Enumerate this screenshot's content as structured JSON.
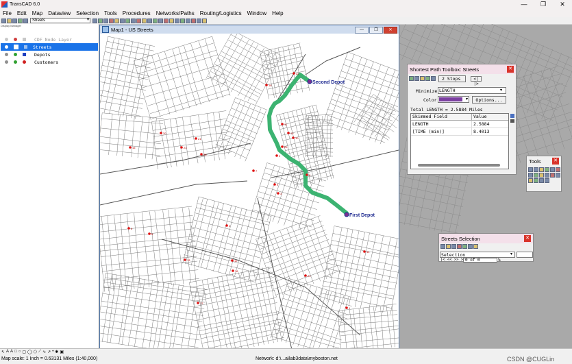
{
  "app": {
    "title": "TransCAD 6.0",
    "minimize": "—",
    "maximize": "❐",
    "close": "✕"
  },
  "menu": [
    "File",
    "Edit",
    "Map",
    "Dataview",
    "Selection",
    "Tools",
    "Procedures",
    "Networks/Paths",
    "Routing/Logistics",
    "Window",
    "Help"
  ],
  "toolbar": {
    "layer_select": "Streets"
  },
  "display_manager": {
    "label": "Display Manager",
    "layers": [
      {
        "name": "CDF Node Layer",
        "selected": false,
        "color": "#d04040",
        "dim": true
      },
      {
        "name": "Streets",
        "selected": true,
        "color": "#4060c0",
        "dim": false
      },
      {
        "name": "Depots",
        "selected": false,
        "color": "#2040c0",
        "dim": false
      },
      {
        "name": "Customers",
        "selected": false,
        "color": "#d02020",
        "dim": false
      }
    ]
  },
  "map_window": {
    "title": "Map1 - US Streets",
    "depot_labels": {
      "second": "Second Depot",
      "first": "First Depot"
    },
    "customer_labels": [
      "22",
      "18",
      "11",
      "19",
      "10",
      "20",
      "21",
      "23",
      "15",
      "26",
      "7",
      "8",
      "9",
      "3",
      "6",
      "5",
      "4",
      "14",
      "13",
      "12",
      "16",
      "24",
      "17",
      "1",
      "2",
      "25"
    ],
    "route_color": "#3cb371"
  },
  "shortest_path": {
    "title": "Shortest Path Toolbox: Streets",
    "stops": "2 Stops",
    "minimize_label": "Minimize",
    "minimize_value": "LENGTH",
    "color_label": "Color",
    "color_value": "#7b3fa0",
    "options_button": "Options...",
    "total": "Total LENGTH = 2.5884 Miles",
    "table": {
      "headers": [
        "Skimmed Field",
        "Value"
      ],
      "rows": [
        [
          "LENGTH",
          "2.5884"
        ],
        [
          "[TIME (min)]",
          "8.4013"
        ]
      ]
    }
  },
  "tools_panel": {
    "title": "Tools"
  },
  "selection_panel": {
    "title": "Streets Selection",
    "dropdown": "Selection",
    "count": "0 of 0",
    "percent": "%"
  },
  "status": {
    "scale": "Map scale: 1 Inch = 0.63131 Miles (1:40,000)",
    "network": "Network: d:\\...a\\lab3data\\myboston.net",
    "watermark": "CSDN @CUGLin"
  }
}
